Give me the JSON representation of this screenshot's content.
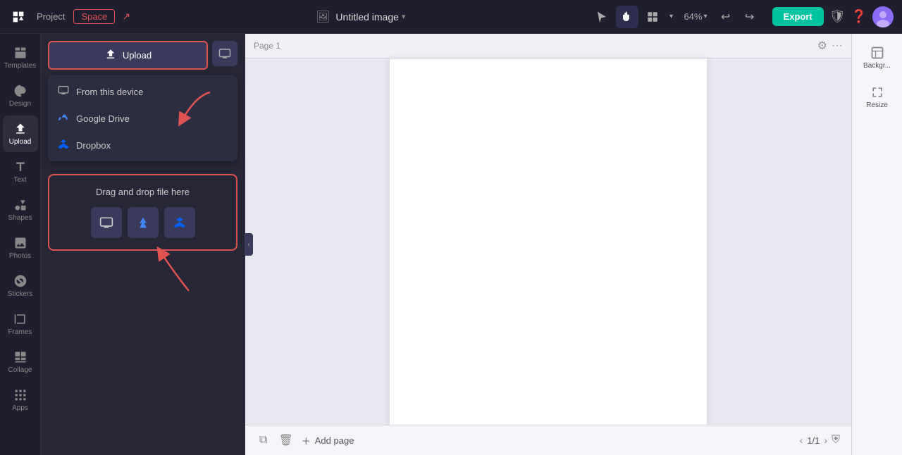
{
  "topbar": {
    "project_label": "Project",
    "space_label": "Space",
    "title": "Untitled image",
    "title_chevron": "▾",
    "zoom": "64%",
    "export_label": "Export"
  },
  "sidebar": {
    "items": [
      {
        "id": "templates",
        "label": "Templates",
        "icon": "grid"
      },
      {
        "id": "design",
        "label": "Design",
        "icon": "brush"
      },
      {
        "id": "upload",
        "label": "Upload",
        "icon": "upload"
      },
      {
        "id": "text",
        "label": "Text",
        "icon": "text"
      },
      {
        "id": "shapes",
        "label": "Shapes",
        "icon": "shapes"
      },
      {
        "id": "photos",
        "label": "Photos",
        "icon": "photos"
      },
      {
        "id": "stickers",
        "label": "Stickers",
        "icon": "stickers"
      },
      {
        "id": "frames",
        "label": "Frames",
        "icon": "frames"
      },
      {
        "id": "collage",
        "label": "Collage",
        "icon": "collage"
      },
      {
        "id": "apps",
        "label": "Apps",
        "icon": "apps"
      }
    ],
    "active": "upload"
  },
  "panel": {
    "upload_label": "Upload",
    "upload_icon": "⬆",
    "dropdown": [
      {
        "id": "from-device",
        "label": "From this device",
        "icon": "💻"
      },
      {
        "id": "google-drive",
        "label": "Google Drive",
        "icon": "🔺"
      },
      {
        "id": "dropbox",
        "label": "Dropbox",
        "icon": "📦"
      }
    ],
    "drag_drop_label": "Drag and drop file here",
    "drag_icons": [
      "💻",
      "⬆",
      "📦"
    ]
  },
  "canvas": {
    "page_label": "Page 1"
  },
  "bottom_bar": {
    "add_page_label": "Add page",
    "page_count": "1/1"
  },
  "right_panel": {
    "background_label": "Backgr...",
    "resize_label": "Resize"
  }
}
